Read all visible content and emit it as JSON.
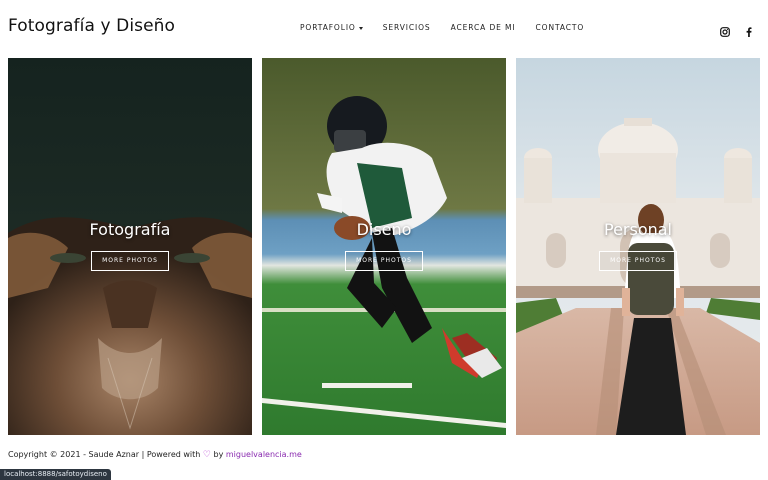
{
  "header": {
    "brand": "Fotografía y Diseño",
    "nav": [
      {
        "label": "PORTAFOLIO",
        "has_dropdown": true
      },
      {
        "label": "SERVICIOS"
      },
      {
        "label": "ACERCA DE MI"
      },
      {
        "label": "CONTACTO"
      }
    ],
    "social_icons": [
      "instagram-icon",
      "facebook-icon"
    ]
  },
  "panels": [
    {
      "title": "Fotografía",
      "button": "MORE PHOTOS"
    },
    {
      "title": "Diseno",
      "button": "MORE PHOTOS"
    },
    {
      "title": "Personal",
      "button": "MORE PHOTOS"
    }
  ],
  "footer": {
    "copyright": "Copyright © 2021 - Saude Aznar | Powered with",
    "heart": "♡",
    "by": "by",
    "link": "miguelvalencia.me"
  },
  "status_bar": {
    "url": "localhost:8888/safotoydiseno"
  },
  "colors": {
    "link": "#8a2bb0",
    "heart": "#b02ad0"
  }
}
